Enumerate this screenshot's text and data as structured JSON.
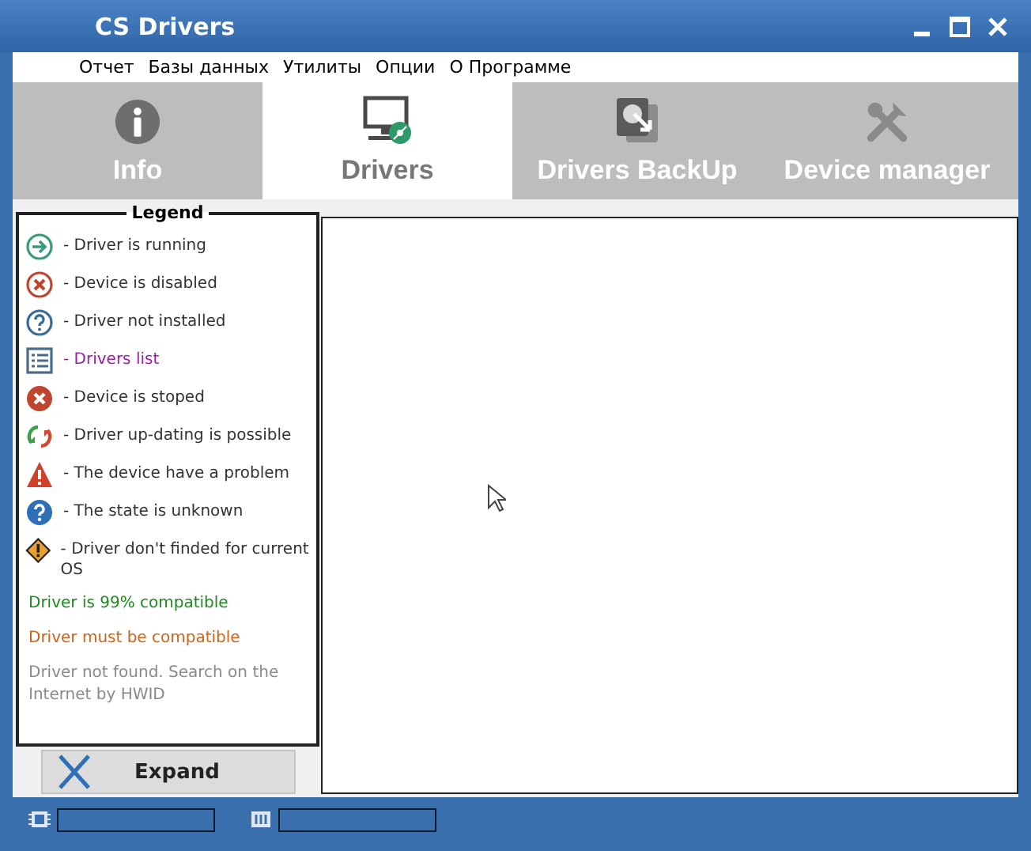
{
  "window": {
    "title": "CS Drivers"
  },
  "menu": [
    {
      "label": "Отчет"
    },
    {
      "label": "Базы данных"
    },
    {
      "label": "Утилиты"
    },
    {
      "label": "Опции"
    },
    {
      "label": "О Программе"
    }
  ],
  "tabs": [
    {
      "label": "Info",
      "kind": "info",
      "selected": false
    },
    {
      "label": "Drivers",
      "kind": "monitor",
      "selected": true
    },
    {
      "label": "Drivers BackUp",
      "kind": "backup",
      "selected": false
    },
    {
      "label": "Device manager",
      "kind": "tools",
      "selected": false
    }
  ],
  "legend": {
    "title": "Legend",
    "items": [
      {
        "kind": "running",
        "text": "- Driver is running"
      },
      {
        "kind": "disabled",
        "text": "- Device is disabled"
      },
      {
        "kind": "not_installed",
        "text": "- Driver not installed"
      },
      {
        "kind": "list",
        "text": "- Drivers list",
        "color": "#9b1fa0"
      },
      {
        "kind": "stopped",
        "text": "- Device is stoped"
      },
      {
        "kind": "update",
        "text": "- Driver up-dating is possible"
      },
      {
        "kind": "problem",
        "text": "- The device have a problem"
      },
      {
        "kind": "unknown",
        "text": "- The state is unknown"
      },
      {
        "kind": "not_found",
        "text": "- Driver don't finded for current OS"
      }
    ],
    "notes": [
      {
        "text": "Driver is 99% compatible",
        "color": "#1f8a1f"
      },
      {
        "text": "Driver must be compatible",
        "color": "#d0651a"
      },
      {
        "text": "Driver not found. Search on the Internet by HWID",
        "color": "#8a8a8a"
      }
    ]
  },
  "expand_button": {
    "label": "Expand"
  }
}
